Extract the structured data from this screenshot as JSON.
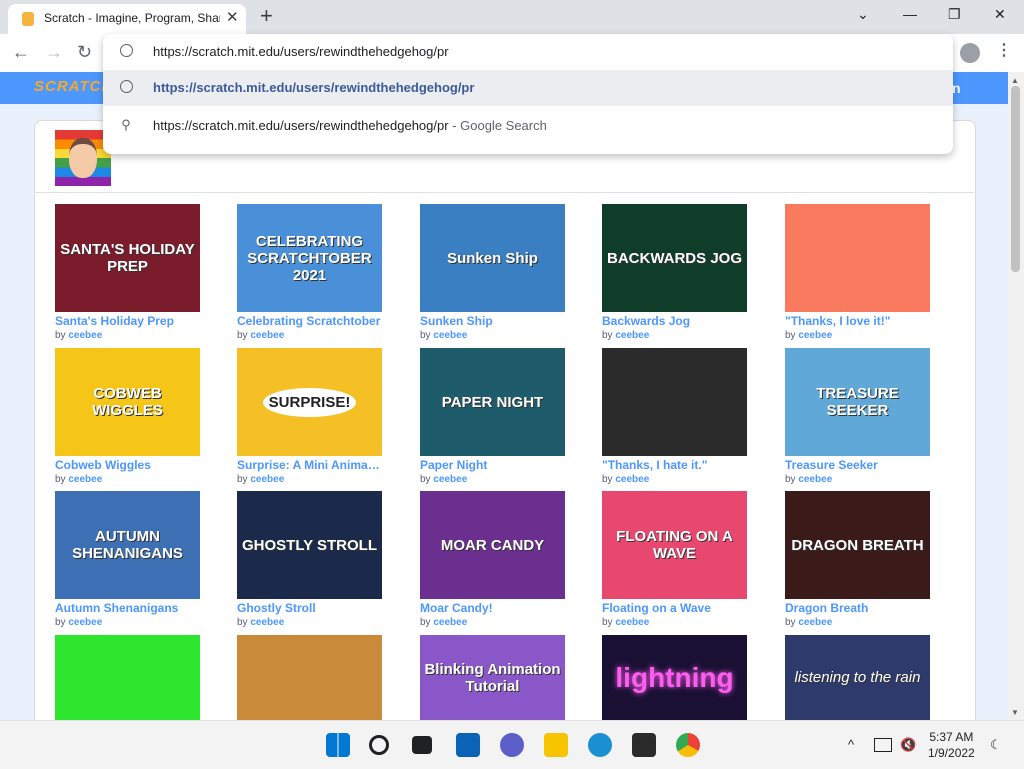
{
  "browser": {
    "tab_title": "Scratch - Imagine, Program, Share",
    "tab_close": "✕",
    "new_tab": "+",
    "window_controls": [
      "⌄",
      "—",
      "❐",
      "✕"
    ],
    "nav": {
      "back": "←",
      "forward": "→",
      "reload": "↻"
    },
    "menu": "⋮"
  },
  "omnibox": {
    "input_value": "https://scratch.mit.edu/users/rewindthehedgehog/pr",
    "suggestions": [
      {
        "text": "https://scratch.mit.edu/users/rewindthehedgehog/pr",
        "suffix": ""
      },
      {
        "text": "https://scratch.mit.edu/users/rewindthehedgehog/pr",
        "suffix": "- Google Search"
      }
    ]
  },
  "scratch": {
    "logo": "SCRATCH",
    "nav_right": "n"
  },
  "projects": [
    {
      "title": "Santa's Holiday Prep",
      "thumb": "SANTA'S HOLIDAY PREP",
      "by": "by",
      "author": "ceebee",
      "bg": "#7b1c2c"
    },
    {
      "title": "Celebrating Scratchtober",
      "thumb": "CELEBRATING SCRATCHTOBER 2021",
      "by": "by",
      "author": "ceebee",
      "bg": "#4a90d9"
    },
    {
      "title": "Sunken Ship",
      "thumb": "Sunken Ship",
      "by": "by",
      "author": "ceebee",
      "bg": "#3a7fc1"
    },
    {
      "title": "Backwards Jog",
      "thumb": "BACKWARDS JOG",
      "by": "by",
      "author": "ceebee",
      "bg": "#0f3d2a"
    },
    {
      "title": "\"Thanks, I love it!\"",
      "thumb": "",
      "by": "by",
      "author": "ceebee",
      "bg": "#f97a5f"
    },
    {
      "title": "Cobweb Wiggles",
      "thumb": "COBWEB WIGGLES",
      "by": "by",
      "author": "ceebee",
      "bg": "#f5c518"
    },
    {
      "title": "Surprise: A Mini Animation",
      "thumb": "SURPRISE!",
      "by": "by",
      "author": "ceebee",
      "bg": "#f4c025"
    },
    {
      "title": "Paper Night",
      "thumb": "PAPER NIGHT",
      "by": "by",
      "author": "ceebee",
      "bg": "#1f5c6b"
    },
    {
      "title": "\"Thanks, I hate it.\"",
      "thumb": "",
      "by": "by",
      "author": "ceebee",
      "bg": "#2b2b2b"
    },
    {
      "title": "Treasure Seeker",
      "thumb": "TREASURE SEEKER",
      "by": "by",
      "author": "ceebee",
      "bg": "#5fa8d8"
    },
    {
      "title": "Autumn Shenanigans",
      "thumb": "AUTUMN SHENANIGANS",
      "by": "by",
      "author": "ceebee",
      "bg": "#3d6fb5"
    },
    {
      "title": "Ghostly Stroll",
      "thumb": "GHOSTLY STROLL",
      "by": "by",
      "author": "ceebee",
      "bg": "#1b2a4a"
    },
    {
      "title": "Moar Candy!",
      "thumb": "MOAR CANDY",
      "by": "by",
      "author": "ceebee",
      "bg": "#6b2f8f"
    },
    {
      "title": "Floating on a Wave",
      "thumb": "FLOATING ON A WAVE",
      "by": "by",
      "author": "ceebee",
      "bg": "#e8486f"
    },
    {
      "title": "Dragon Breath",
      "thumb": "DRAGON BREATH",
      "by": "by",
      "author": "ceebee",
      "bg": "#3b1a1a"
    },
    {
      "title": "",
      "thumb": "",
      "by": "",
      "author": "",
      "bg": "#2ee62e"
    },
    {
      "title": "",
      "thumb": "",
      "by": "",
      "author": "",
      "bg": "#c98b3a"
    },
    {
      "title": "",
      "thumb": "Blinking Animation Tutorial",
      "by": "",
      "author": "",
      "bg": "#8a57c9"
    },
    {
      "title": "",
      "thumb": "lightning",
      "by": "",
      "author": "",
      "bg": "#1a1033"
    },
    {
      "title": "",
      "thumb": "listening to the rain",
      "by": "",
      "author": "",
      "bg": "#2d3a6b"
    }
  ],
  "taskbar": {
    "time": "5:37 AM",
    "date": "1/9/2022",
    "tray_chevron": "^"
  }
}
